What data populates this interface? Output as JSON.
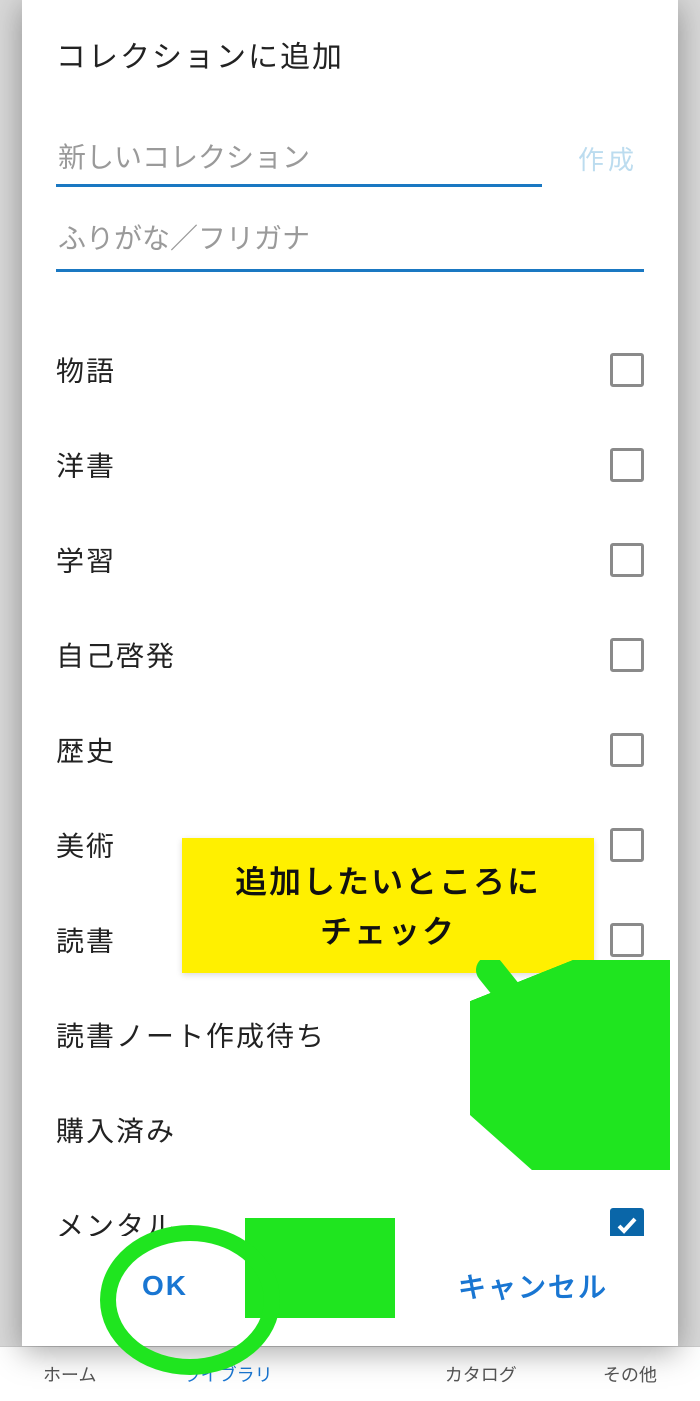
{
  "modal": {
    "title": "コレクションに追加",
    "new_collection_placeholder": "新しいコレクション",
    "furigana_placeholder": "ふりがな／フリガナ",
    "create_label": "作成",
    "ok_label": "OK",
    "cancel_label": "キャンセル"
  },
  "collections": [
    {
      "label": "物語",
      "checked": false
    },
    {
      "label": "洋書",
      "checked": false
    },
    {
      "label": "学習",
      "checked": false
    },
    {
      "label": "自己啓発",
      "checked": false
    },
    {
      "label": "歴史",
      "checked": false
    },
    {
      "label": "美術",
      "checked": false
    },
    {
      "label": "読書",
      "checked": false
    },
    {
      "label": "読書ノート作成待ち",
      "checked": false
    },
    {
      "label": "購入済み",
      "checked": false
    },
    {
      "label": "メンタル",
      "checked": true
    }
  ],
  "bottom_nav": {
    "items": [
      {
        "label": "ホーム"
      },
      {
        "label": "ライブラリ"
      },
      {
        "label": ""
      },
      {
        "label": "カタログ"
      },
      {
        "label": "その他"
      }
    ]
  },
  "annotations": {
    "callout_line1": "追加したいところに",
    "callout_line2": "チェック"
  }
}
